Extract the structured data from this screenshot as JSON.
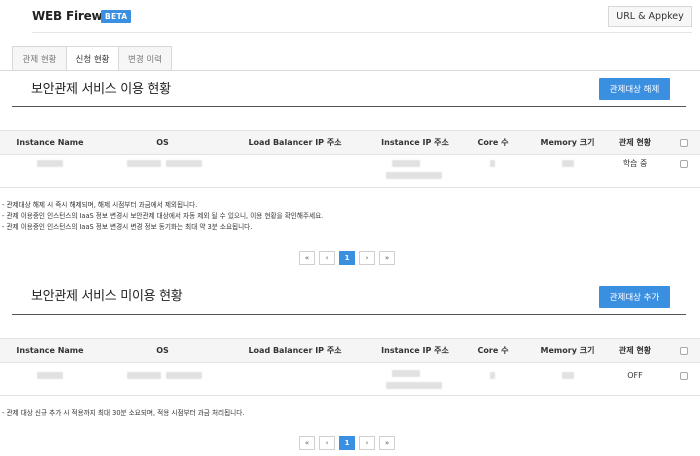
{
  "header": {
    "title": "WEB Firewall",
    "badge": "BETA",
    "appkey_button": "URL & Appkey"
  },
  "tabs": [
    {
      "label": "관제 현황",
      "active": false
    },
    {
      "label": "신청 현황",
      "active": true
    },
    {
      "label": "변경 이력",
      "active": false
    }
  ],
  "columns": [
    "Instance Name",
    "OS",
    "Load Balancer IP 주소",
    "Instance IP 주소",
    "Core 수",
    "Memory 크기",
    "관제 현황"
  ],
  "sections": [
    {
      "title": "보안관제 서비스 이용 현황",
      "button": "관제대상 해제",
      "rows": [
        {
          "status": "학습 중"
        }
      ],
      "notes": [
        "- 관제대상 해제 시 즉시 해제되며, 해제 시점부터 과금에서 제외됩니다.",
        "- 관제 이용중인 인스턴스의 IaaS 정보 변경시 보안관제 대상에서 자동 제외 될 수 있으니, 이용 현황을 확인해주세요.",
        "- 관제 이용중인 인스턴스의 IaaS 정보 변경시 변경 정보 동기화는 최대 약 3분 소요됩니다."
      ]
    },
    {
      "title": "보안관제 서비스 미이용 현황",
      "button": "관제대상 추가",
      "rows": [
        {
          "status": "OFF"
        }
      ],
      "notes": [
        "- 관제 대상 신규 추가 시 적용까지 최대 30분 소요되며, 적용 시점부터 과금 처리됩니다."
      ]
    }
  ],
  "pagination": {
    "first": "«",
    "prev": "‹",
    "current": "1",
    "next": "›",
    "last": "»"
  },
  "colors": {
    "accent": "#3b8fe0",
    "header_bg": "#f5f5f5"
  }
}
